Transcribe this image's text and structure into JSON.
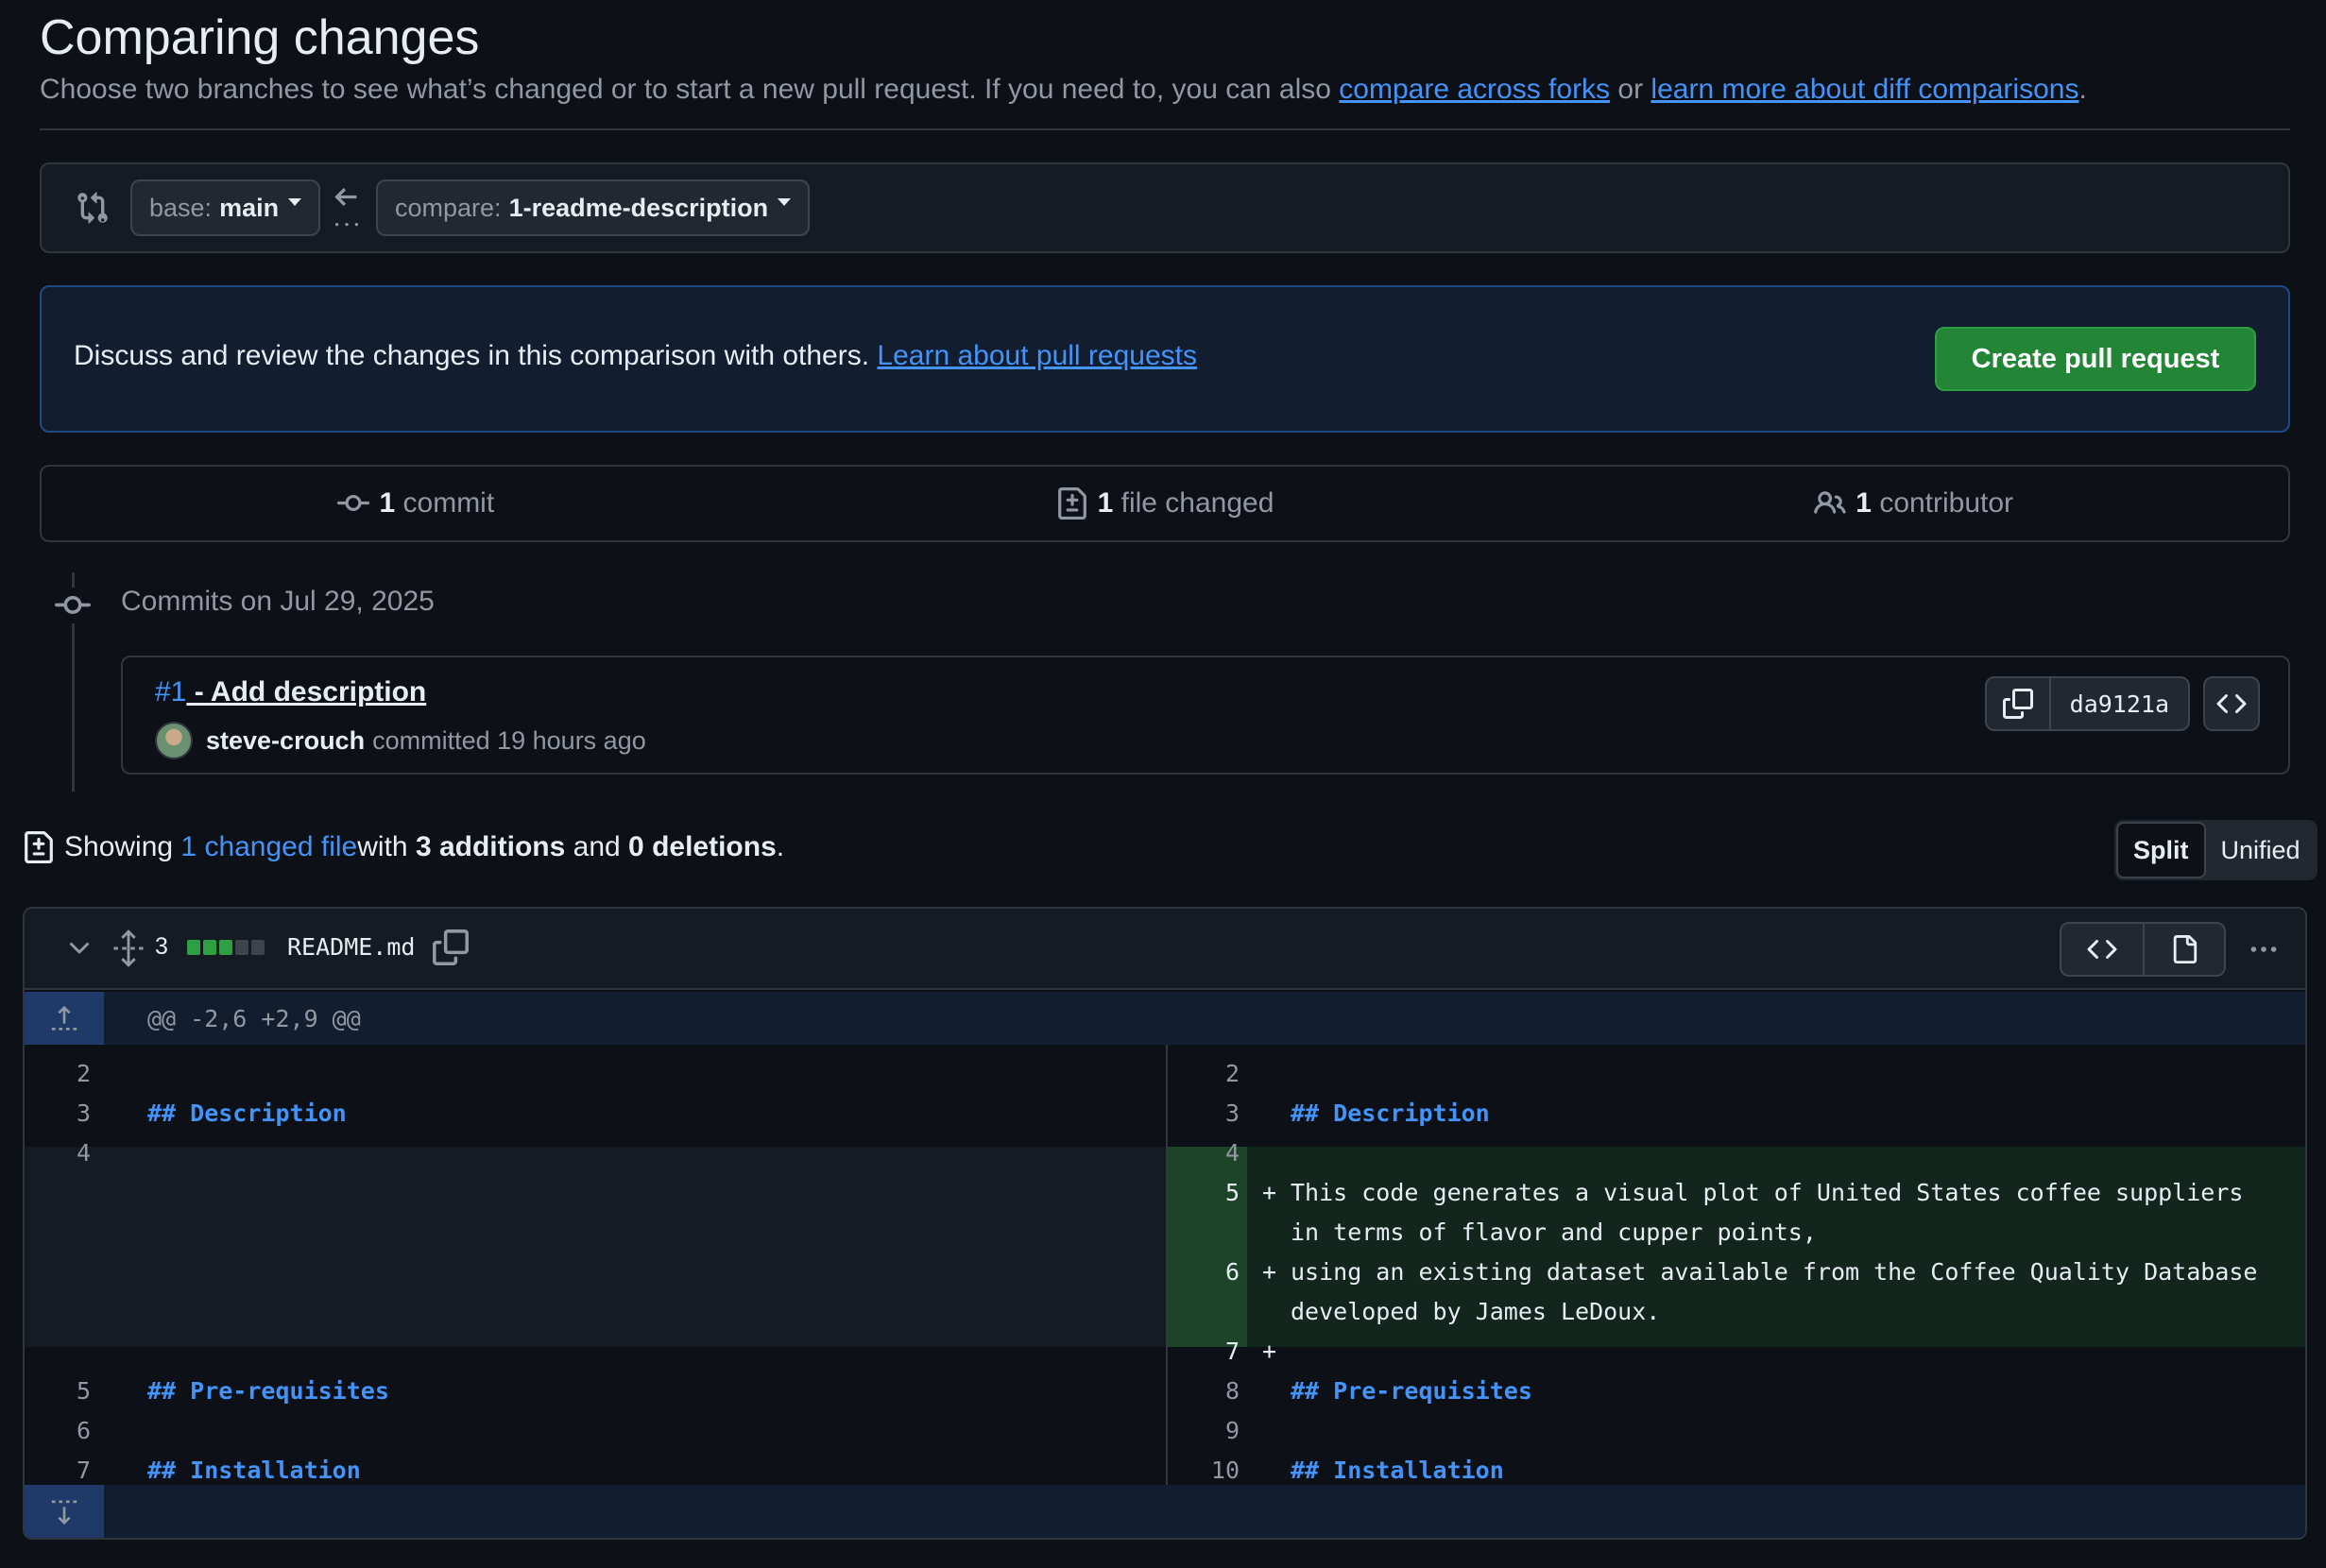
{
  "header": {
    "title": "Comparing changes",
    "desc_prefix": "Choose two branches to see what’s changed or to start a new pull request. If you need to, you can also ",
    "link_forks": "compare across forks",
    "desc_or": " or ",
    "link_learn": "learn more about diff comparisons",
    "desc_suffix": "."
  },
  "range": {
    "base_label": "base:",
    "base_value": "main",
    "compare_label": "compare:",
    "compare_value": "1-readme-description"
  },
  "flash": {
    "text": "Discuss and review the changes in this comparison with others. ",
    "link": "Learn about pull requests",
    "button": "Create pull request"
  },
  "summary": {
    "commits_count": "1",
    "commits_label": "commit",
    "files_count": "1",
    "files_label": "file changed",
    "contributors_count": "1",
    "contributors_label": "contributor"
  },
  "commits": {
    "date_heading": "Commits on Jul 29, 2025",
    "items": [
      {
        "number": "#1",
        "message": " - Add description",
        "author": "steve-crouch",
        "action": "committed 19 hours ago",
        "sha": "da9121a"
      }
    ]
  },
  "showing": {
    "prefix": "Showing ",
    "link": "1 changed file",
    "mid1": " with ",
    "additions": "3 additions",
    "mid2": " and ",
    "deletions": "0 deletions",
    "suffix": ".",
    "view_split": "Split",
    "view_unified": "Unified"
  },
  "file": {
    "change_count": "3",
    "name": "README.md",
    "diffstat_colors": [
      "#2ea043",
      "#2ea043",
      "#2ea043",
      "#3d444d",
      "#3d444d"
    ],
    "hunk_header": "@@ -2,6 +2,9 @@",
    "left_lines": [
      {
        "n": "2",
        "text": ""
      },
      {
        "n": "3",
        "text": "## Description"
      },
      {
        "n": "4",
        "text": ""
      },
      {
        "n": "5",
        "text": "## Pre-requisites"
      },
      {
        "n": "6",
        "text": ""
      },
      {
        "n": "7",
        "text": "## Installation"
      }
    ],
    "right_lines": [
      {
        "n": "2",
        "text": ""
      },
      {
        "n": "3",
        "text": "## Description"
      },
      {
        "n": "4",
        "text": ""
      },
      {
        "n": "5",
        "text": "This code generates a visual plot of United States coffee suppliers"
      },
      {
        "n": "",
        "text": "in terms of flavor and cupper points,"
      },
      {
        "n": "6",
        "text": "using an existing dataset available from the Coffee Quality Database"
      },
      {
        "n": "",
        "text": "developed by James LeDoux."
      },
      {
        "n": "7",
        "text": ""
      },
      {
        "n": "8",
        "text": "## Pre-requisites"
      },
      {
        "n": "9",
        "text": ""
      },
      {
        "n": "10",
        "text": "## Installation"
      }
    ],
    "plus_sign": "+"
  }
}
